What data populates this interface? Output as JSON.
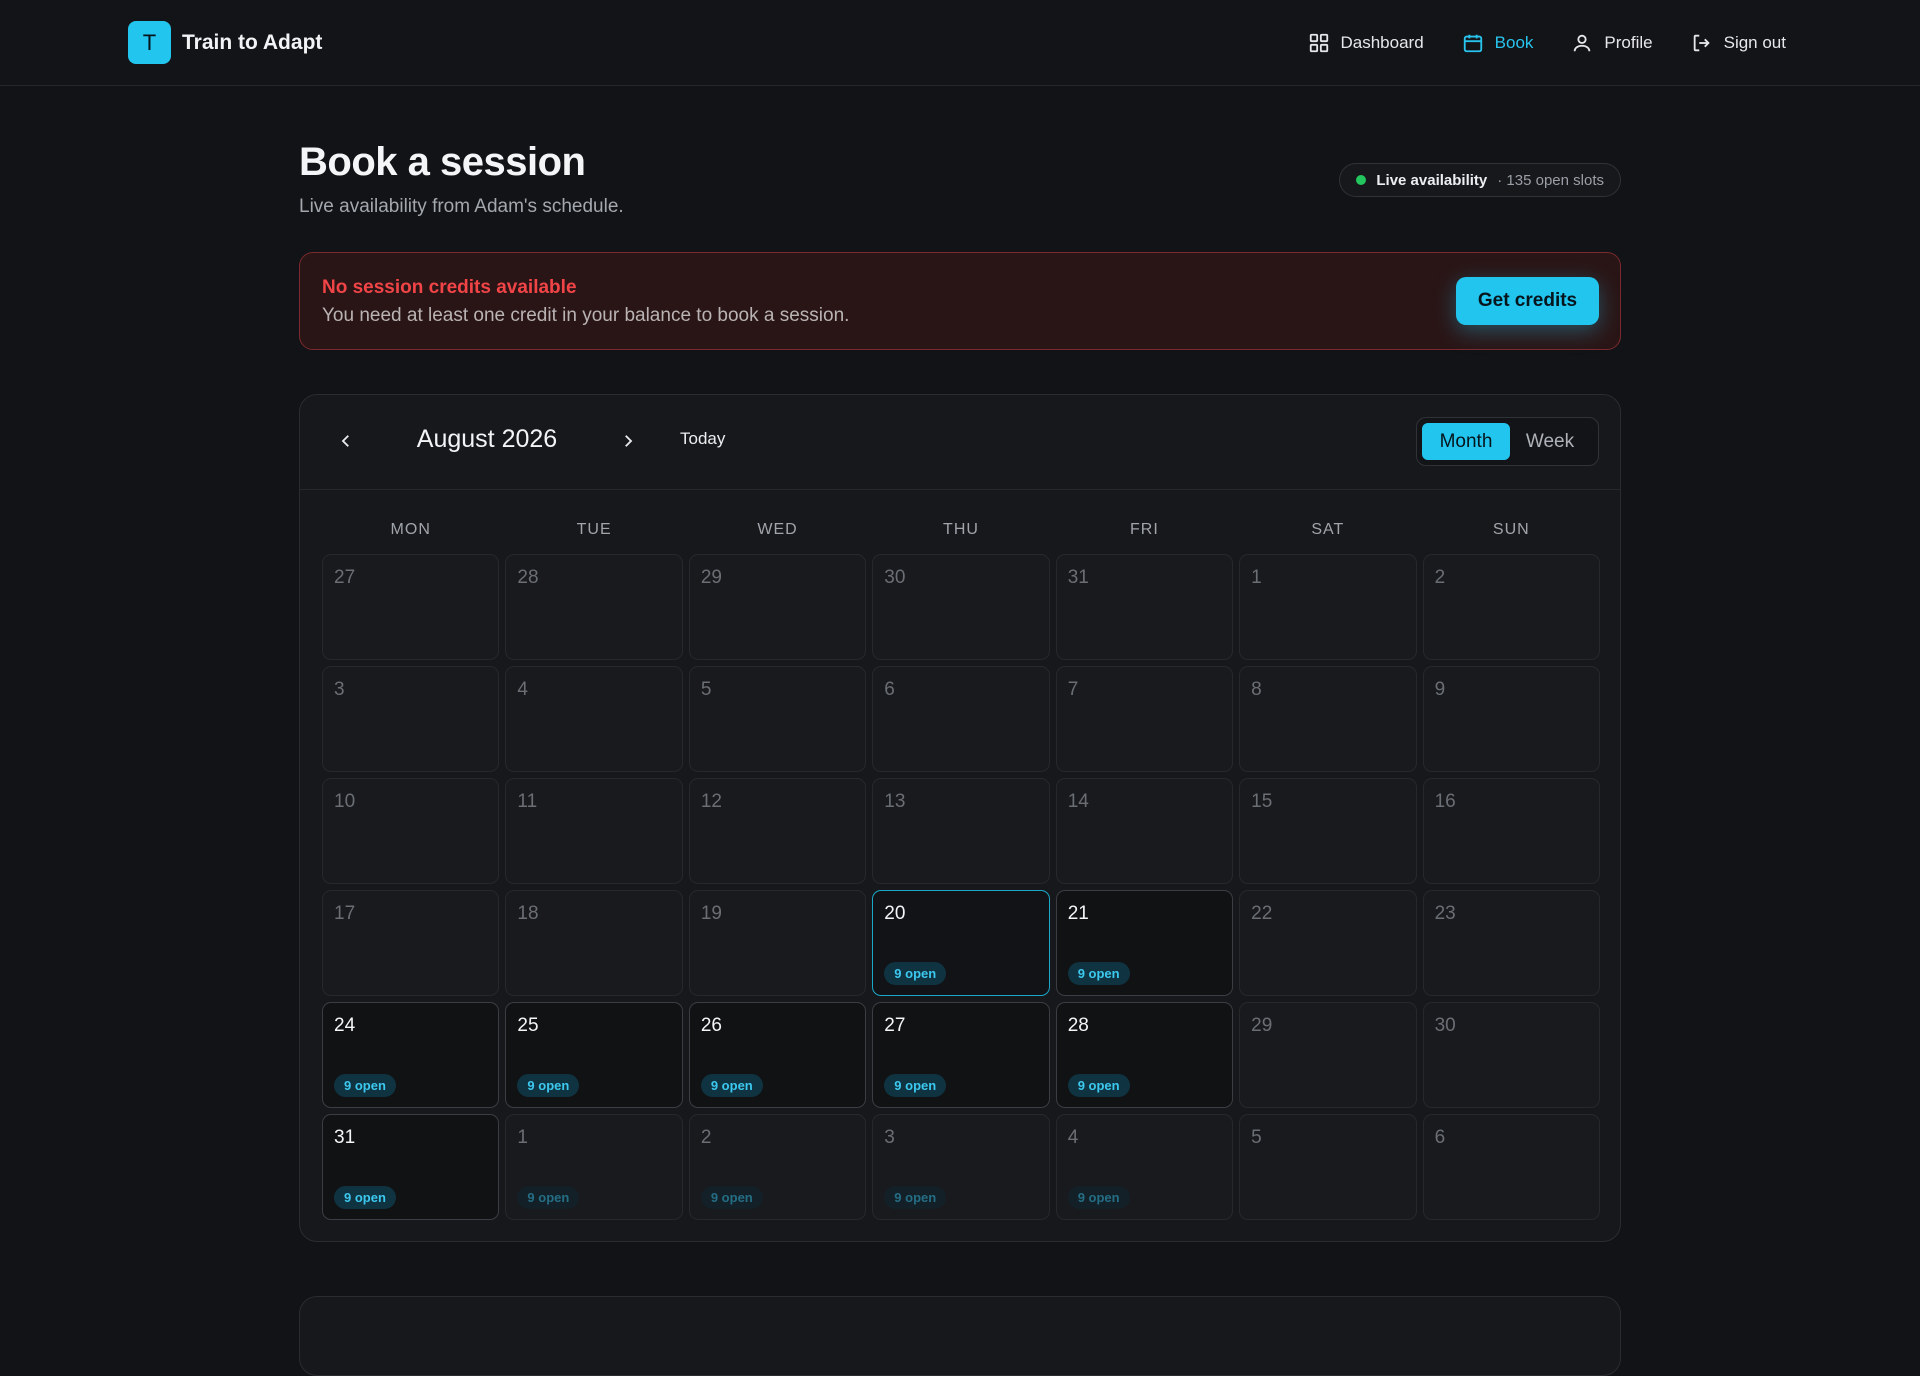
{
  "brand": {
    "logo_letter": "T",
    "name": "Train to Adapt",
    "accent": "#22c5ee"
  },
  "nav": {
    "dashboard": "Dashboard",
    "book": "Book",
    "profile": "Profile",
    "sign_out": "Sign out"
  },
  "page": {
    "title": "Book a session",
    "subtitle": "Live availability from Adam's schedule."
  },
  "live": {
    "label": "Live availability",
    "count": "· 135 open slots",
    "dot_color": "#22c55e"
  },
  "alert": {
    "title": "No session credits available",
    "text": "You need at least one credit in your balance to book a session.",
    "button": "Get credits"
  },
  "calendar": {
    "month_label": "August 2026",
    "today_label": "Today",
    "views": {
      "month": "Month",
      "week": "Week",
      "active": "month"
    },
    "weekdays": [
      "MON",
      "TUE",
      "WED",
      "THU",
      "FRI",
      "SAT",
      "SUN"
    ],
    "days": [
      {
        "day": "27",
        "state": "muted"
      },
      {
        "day": "28",
        "state": "muted"
      },
      {
        "day": "29",
        "state": "muted"
      },
      {
        "day": "30",
        "state": "muted"
      },
      {
        "day": "31",
        "state": "muted"
      },
      {
        "day": "1",
        "state": "muted"
      },
      {
        "day": "2",
        "state": "muted"
      },
      {
        "day": "3",
        "state": "muted"
      },
      {
        "day": "4",
        "state": "muted"
      },
      {
        "day": "5",
        "state": "muted"
      },
      {
        "day": "6",
        "state": "muted"
      },
      {
        "day": "7",
        "state": "muted"
      },
      {
        "day": "8",
        "state": "muted"
      },
      {
        "day": "9",
        "state": "muted"
      },
      {
        "day": "10",
        "state": "muted"
      },
      {
        "day": "11",
        "state": "muted"
      },
      {
        "day": "12",
        "state": "muted"
      },
      {
        "day": "13",
        "state": "muted"
      },
      {
        "day": "14",
        "state": "muted"
      },
      {
        "day": "15",
        "state": "muted"
      },
      {
        "day": "16",
        "state": "muted"
      },
      {
        "day": "17",
        "state": "muted"
      },
      {
        "day": "18",
        "state": "muted"
      },
      {
        "day": "19",
        "state": "muted"
      },
      {
        "day": "20",
        "state": "today",
        "badge": "9 open"
      },
      {
        "day": "21",
        "state": "available",
        "badge": "9 open"
      },
      {
        "day": "22",
        "state": "muted"
      },
      {
        "day": "23",
        "state": "muted"
      },
      {
        "day": "24",
        "state": "available",
        "badge": "9 open"
      },
      {
        "day": "25",
        "state": "available",
        "badge": "9 open"
      },
      {
        "day": "26",
        "state": "available",
        "badge": "9 open"
      },
      {
        "day": "27",
        "state": "available",
        "badge": "9 open"
      },
      {
        "day": "28",
        "state": "available",
        "badge": "9 open"
      },
      {
        "day": "29",
        "state": "muted"
      },
      {
        "day": "30",
        "state": "muted"
      },
      {
        "day": "31",
        "state": "available",
        "badge": "9 open"
      },
      {
        "day": "1",
        "state": "outside",
        "badge": "9 open"
      },
      {
        "day": "2",
        "state": "outside",
        "badge": "9 open"
      },
      {
        "day": "3",
        "state": "outside",
        "badge": "9 open"
      },
      {
        "day": "4",
        "state": "outside",
        "badge": "9 open"
      },
      {
        "day": "5",
        "state": "muted"
      },
      {
        "day": "6",
        "state": "muted"
      }
    ]
  }
}
